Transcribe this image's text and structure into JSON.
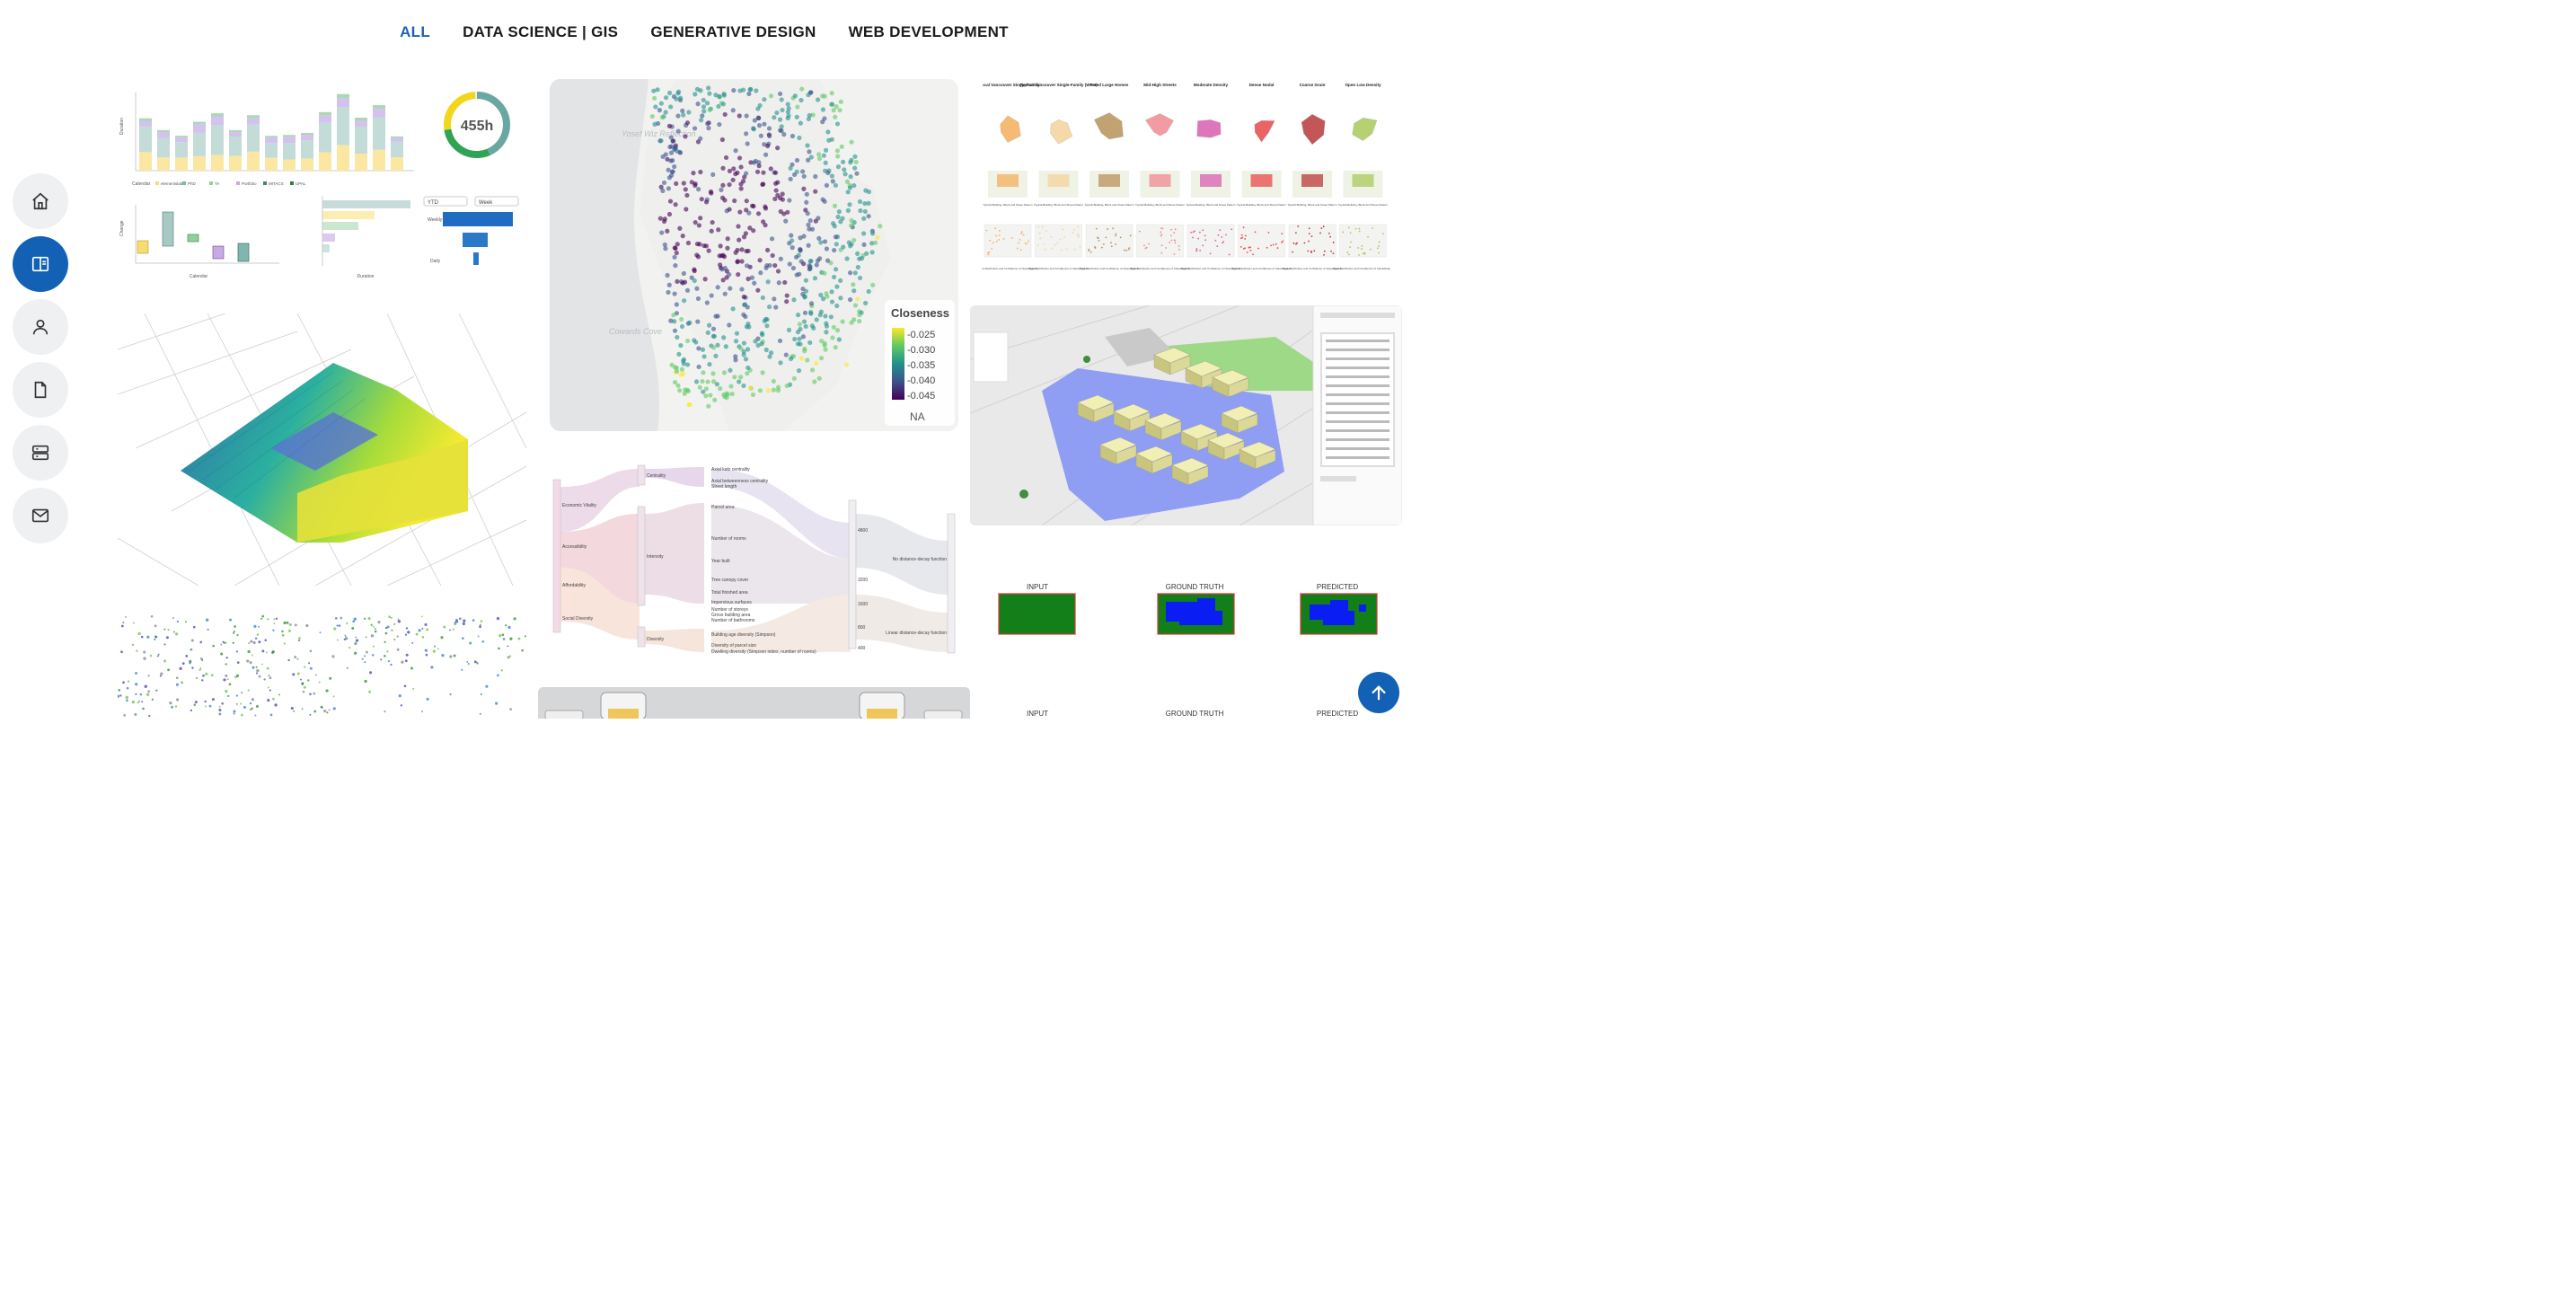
{
  "filters": [
    "ALL",
    "DATA SCIENCE | GIS",
    "GENERATIVE DESIGN",
    "WEB DEVELOPMENT"
  ],
  "active_filter": "ALL",
  "sidebar": [
    {
      "name": "home-icon"
    },
    {
      "name": "book-icon",
      "active": true
    },
    {
      "name": "user-icon"
    },
    {
      "name": "document-icon"
    },
    {
      "name": "server-icon"
    },
    {
      "name": "mail-icon"
    }
  ],
  "colors": {
    "accent": "#1b64b3",
    "nav_active": "#1261b5",
    "nav_bg": "#eef0f2"
  },
  "dashboard": {
    "donut_value": "455h",
    "legend_title": "Calendar",
    "legend": [
      "elementslab",
      "PhD",
      "TA",
      "Portfolio",
      "MITACS",
      "UPAL"
    ],
    "bar_ylabel": "Duration",
    "box_xlabel": "Calendar",
    "box_ylabel": "Change",
    "hbar_xlabel": "Duration",
    "filter_ytd": "YTD",
    "filter_week": "Week",
    "funnel_labels": [
      "Weekly",
      "Daily"
    ]
  },
  "closeness_map": {
    "legend_title": "Closeness",
    "legend_values": [
      "-0.025",
      "-0.030",
      "-0.035",
      "-0.040",
      "-0.045"
    ],
    "legend_na": "NA",
    "map_labels": [
      "Yosef Wiz Reflection",
      "Cowards Cove"
    ]
  },
  "neighbourhood_types": {
    "columns": [
      "Typical Vancouver Single-Family",
      "Typical Vancouver Single-Family (West)",
      "Treed Large Homes",
      "Mid-High Streets",
      "Moderate Density",
      "Dense Nodal",
      "Coarse Grain",
      "Open Low Density"
    ],
    "row2_caption": "Typical Building, Block and Street Pattern",
    "row3_caption": "Type Distribution and Confidence of Classification"
  },
  "sankey": {
    "left": [
      "Economic Vitality",
      "Accessibility",
      "Affordability",
      "Social Diversity"
    ],
    "mid": [
      "Centrality",
      "Intensity",
      "Diversity"
    ],
    "right": [
      "Axial katz centrality",
      "Axial betweenness centrality",
      "Street length",
      "Parcel area",
      "Number of rooms",
      "Year built",
      "Tree canopy cover",
      "Impervious surfaces",
      "Total finished area",
      "Number of storeys",
      "Gross building area",
      "Number of bathrooms",
      "Building age diversity (Simpson)",
      "Diversity of parcel size",
      "Dwelling diversity (Simpson index, number of rooms)"
    ],
    "distance": [
      "4800",
      "3200",
      "1600",
      "800",
      "400"
    ],
    "functions": [
      "No distance-decay function",
      "Linear distance-decay function"
    ]
  },
  "prediction": {
    "labels": [
      "INPUT",
      "GROUND TRUTH",
      "PREDICTED"
    ]
  }
}
